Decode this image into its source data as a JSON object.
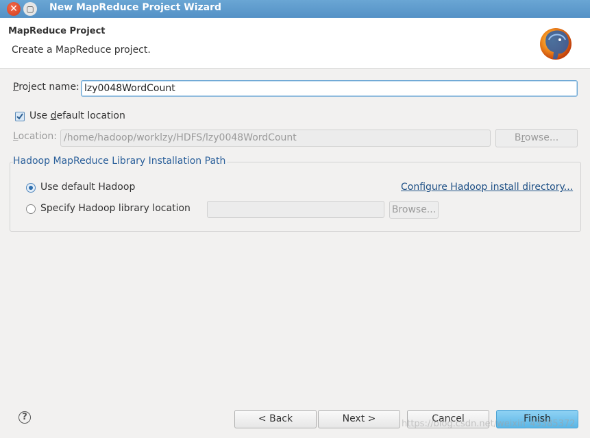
{
  "window": {
    "title": "New MapReduce Project Wizard",
    "close_icon": "close-icon",
    "maximize_icon": "maximize-icon"
  },
  "header": {
    "title": "MapReduce Project",
    "description": "Create a MapReduce project.",
    "logo_icon": "hadoop-elephant-logo"
  },
  "project_name": {
    "label_underlined": "P",
    "label_rest": "roject name:",
    "value": "lzy0048WordCount"
  },
  "use_default_location": {
    "checked": true,
    "label_before": "Use ",
    "label_underlined": "d",
    "label_after": "efault location"
  },
  "location": {
    "label_underlined": "L",
    "label_rest": "ocation:",
    "value": "/home/hadoop/worklzy/HDFS/lzy0048WordCount",
    "browse_before": "B",
    "browse_underlined": "r",
    "browse_after": "owse..."
  },
  "hadoop_group": {
    "title": "Hadoop MapReduce Library Installation Path",
    "use_default_label": "Use default Hadoop",
    "use_default_selected": true,
    "configure_link": "Configure Hadoop install directory...",
    "specify_label": "Specify Hadoop library location",
    "specify_value": "",
    "browse_label": "Browse..."
  },
  "footer": {
    "help_icon": "help-icon",
    "back_label": "< Back",
    "back_underlined": "B",
    "next_label": "Next >",
    "cancel_label": "Cancel",
    "finish_label": "Finish"
  },
  "watermark": "https://blog.csdn.net/weixin_43385372",
  "colors": {
    "titlebar": "#5a97cb",
    "primary_button": "#6cc0ea",
    "link": "#1d4f85"
  }
}
